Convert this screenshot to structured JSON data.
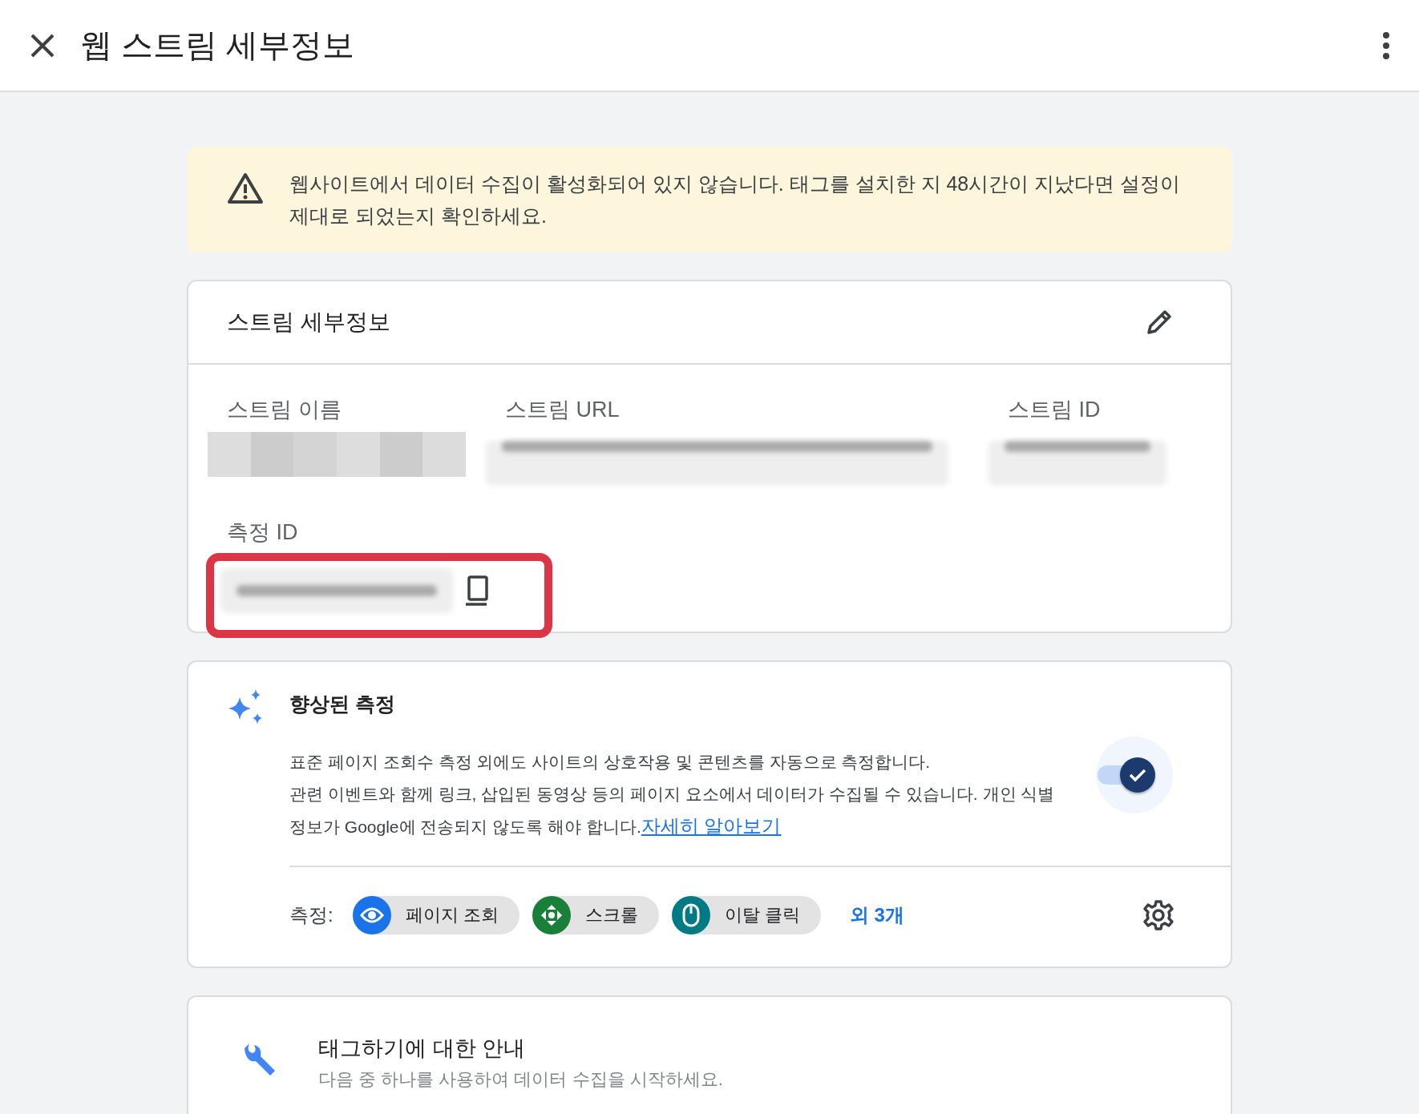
{
  "header": {
    "title": "웹 스트림 세부정보"
  },
  "warning": {
    "text": "웹사이트에서 데이터 수집이 활성화되어 있지 않습니다. 태그를 설치한 지 48시간이 지났다면 설정이 제대로 되었는지 확인하세요."
  },
  "stream_details": {
    "title": "스트림 세부정보",
    "fields": [
      {
        "label": "스트림 이름",
        "kind": "pixelated"
      },
      {
        "label": "스트림 URL",
        "kind": "blurred"
      },
      {
        "label": "스트림 ID",
        "kind": "blurred"
      }
    ],
    "measurement_id": {
      "label": "측정 ID",
      "highlighted": true
    }
  },
  "enhanced_measurement": {
    "title": "향상된 측정",
    "description_lines": [
      "표준 페이지 조회수 측정 외에도 사이트의 상호작용 및 콘텐츠를 자동으로 측정합니다.",
      "관련 이벤트와 함께 링크, 삽입된 동영상 등의 페이지 요소에서 데이터가 수집될 수 있습니다. 개인 식별 정보가 Google에 전송되지 않도록 해야 합니다."
    ],
    "link": "자세히 알아보기",
    "on": true,
    "measurements_label": "측정:",
    "chips": [
      {
        "label": "페이지 조회",
        "kind": "eye",
        "color": "#1a73e8"
      },
      {
        "label": "스크롤",
        "kind": "scroll",
        "color": "#188038"
      },
      {
        "label": "이탈 클릭",
        "kind": "mouse",
        "color": "#007b83"
      }
    ],
    "more": "외 3개"
  },
  "tagging": {
    "title": "태그하기에 대한 안내",
    "subtitle": "다음 중 하나를 사용하여 데이터 수집을 시작하세요."
  }
}
